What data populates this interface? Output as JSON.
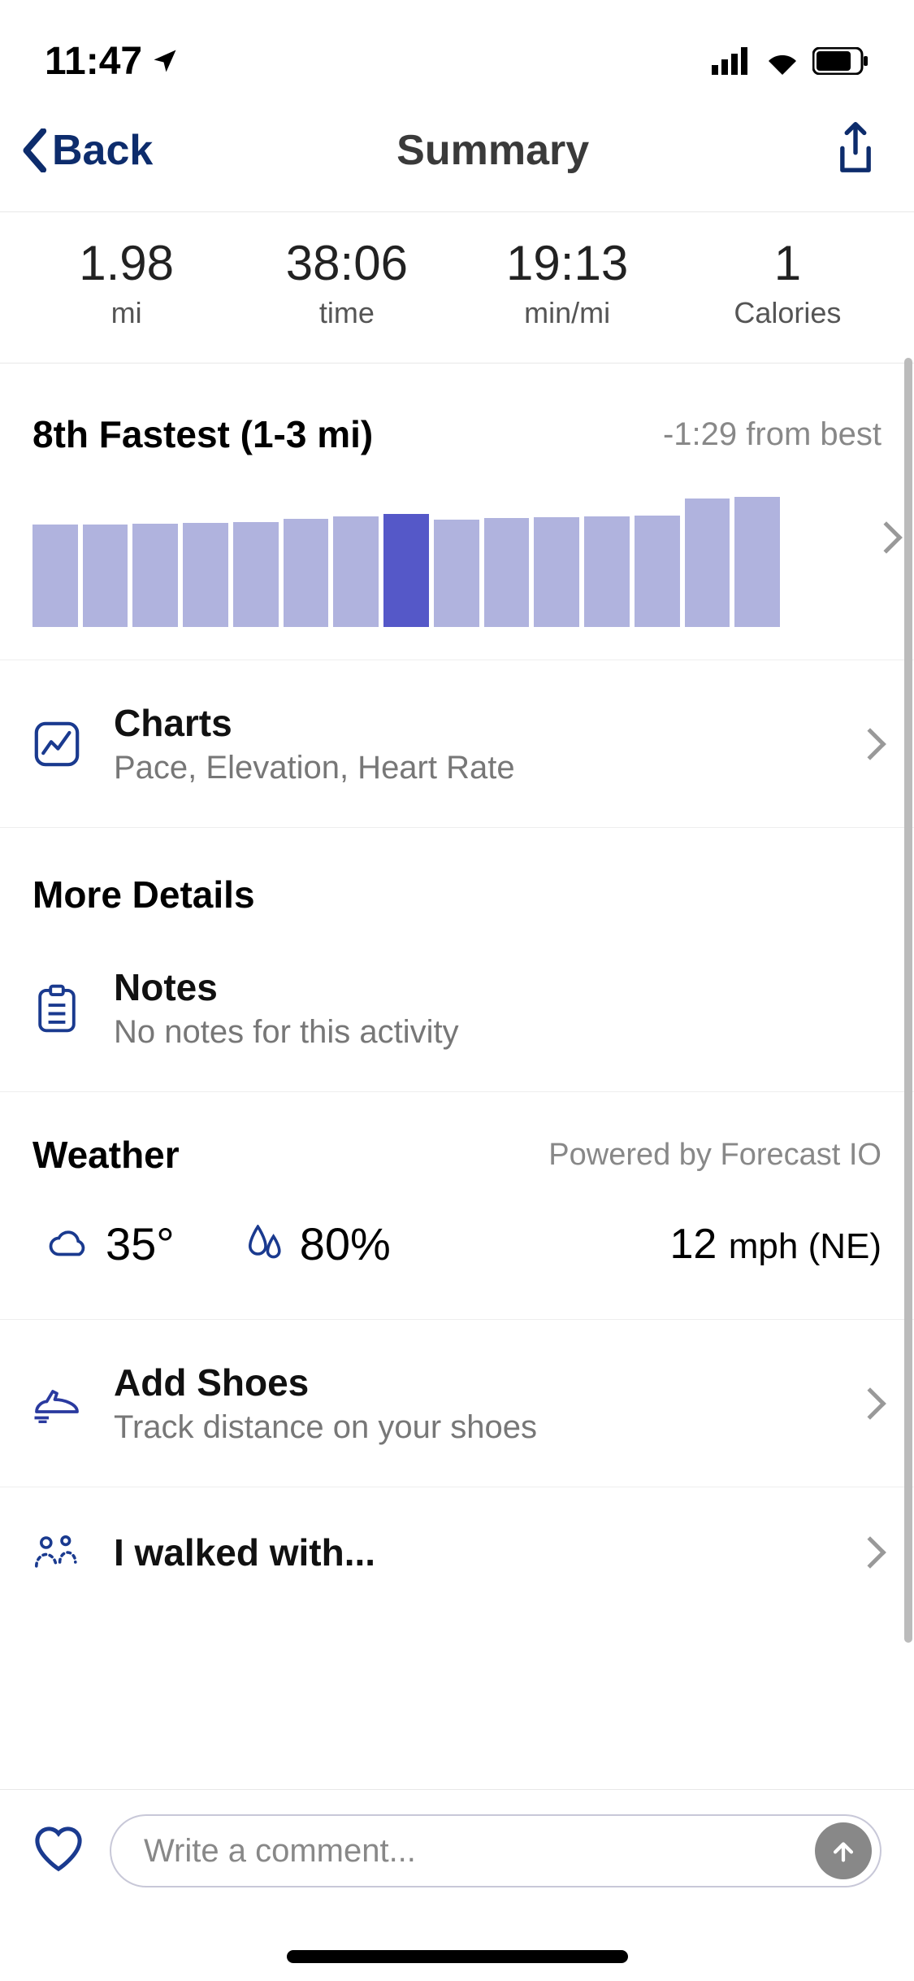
{
  "status": {
    "time": "11:47"
  },
  "nav": {
    "back": "Back",
    "title": "Summary"
  },
  "stats": [
    {
      "value": "1.98",
      "label": "mi"
    },
    {
      "value": "38:06",
      "label": "time"
    },
    {
      "value": "19:13",
      "label": "min/mi"
    },
    {
      "value": "1",
      "label": "Calories"
    }
  ],
  "rank": {
    "title": "8th Fastest (1-3 mi)",
    "diff": "-1:29 from best"
  },
  "chart_data": {
    "type": "bar",
    "title": "8th Fastest (1-3 mi)",
    "note": "Bar heights are relative pixel heights read from the screenshot; no numeric axis is shown.",
    "highlighted_index": 7,
    "values": [
      140,
      140,
      141,
      142,
      144,
      148,
      151,
      155,
      147,
      149,
      150,
      151,
      152,
      176,
      178
    ]
  },
  "charts_row": {
    "title": "Charts",
    "sub": "Pace, Elevation, Heart Rate"
  },
  "more_details": {
    "title": "More Details"
  },
  "notes": {
    "title": "Notes",
    "sub": "No notes for this activity"
  },
  "weather": {
    "title": "Weather",
    "powered": "Powered by Forecast IO",
    "temp": "35°",
    "humidity": "80%",
    "wind_speed": "12",
    "wind_unit": "mph (NE)"
  },
  "shoes": {
    "title": "Add Shoes",
    "sub": "Track distance on your shoes"
  },
  "walked": {
    "title": "I walked with..."
  },
  "comment": {
    "placeholder": "Write a comment..."
  }
}
